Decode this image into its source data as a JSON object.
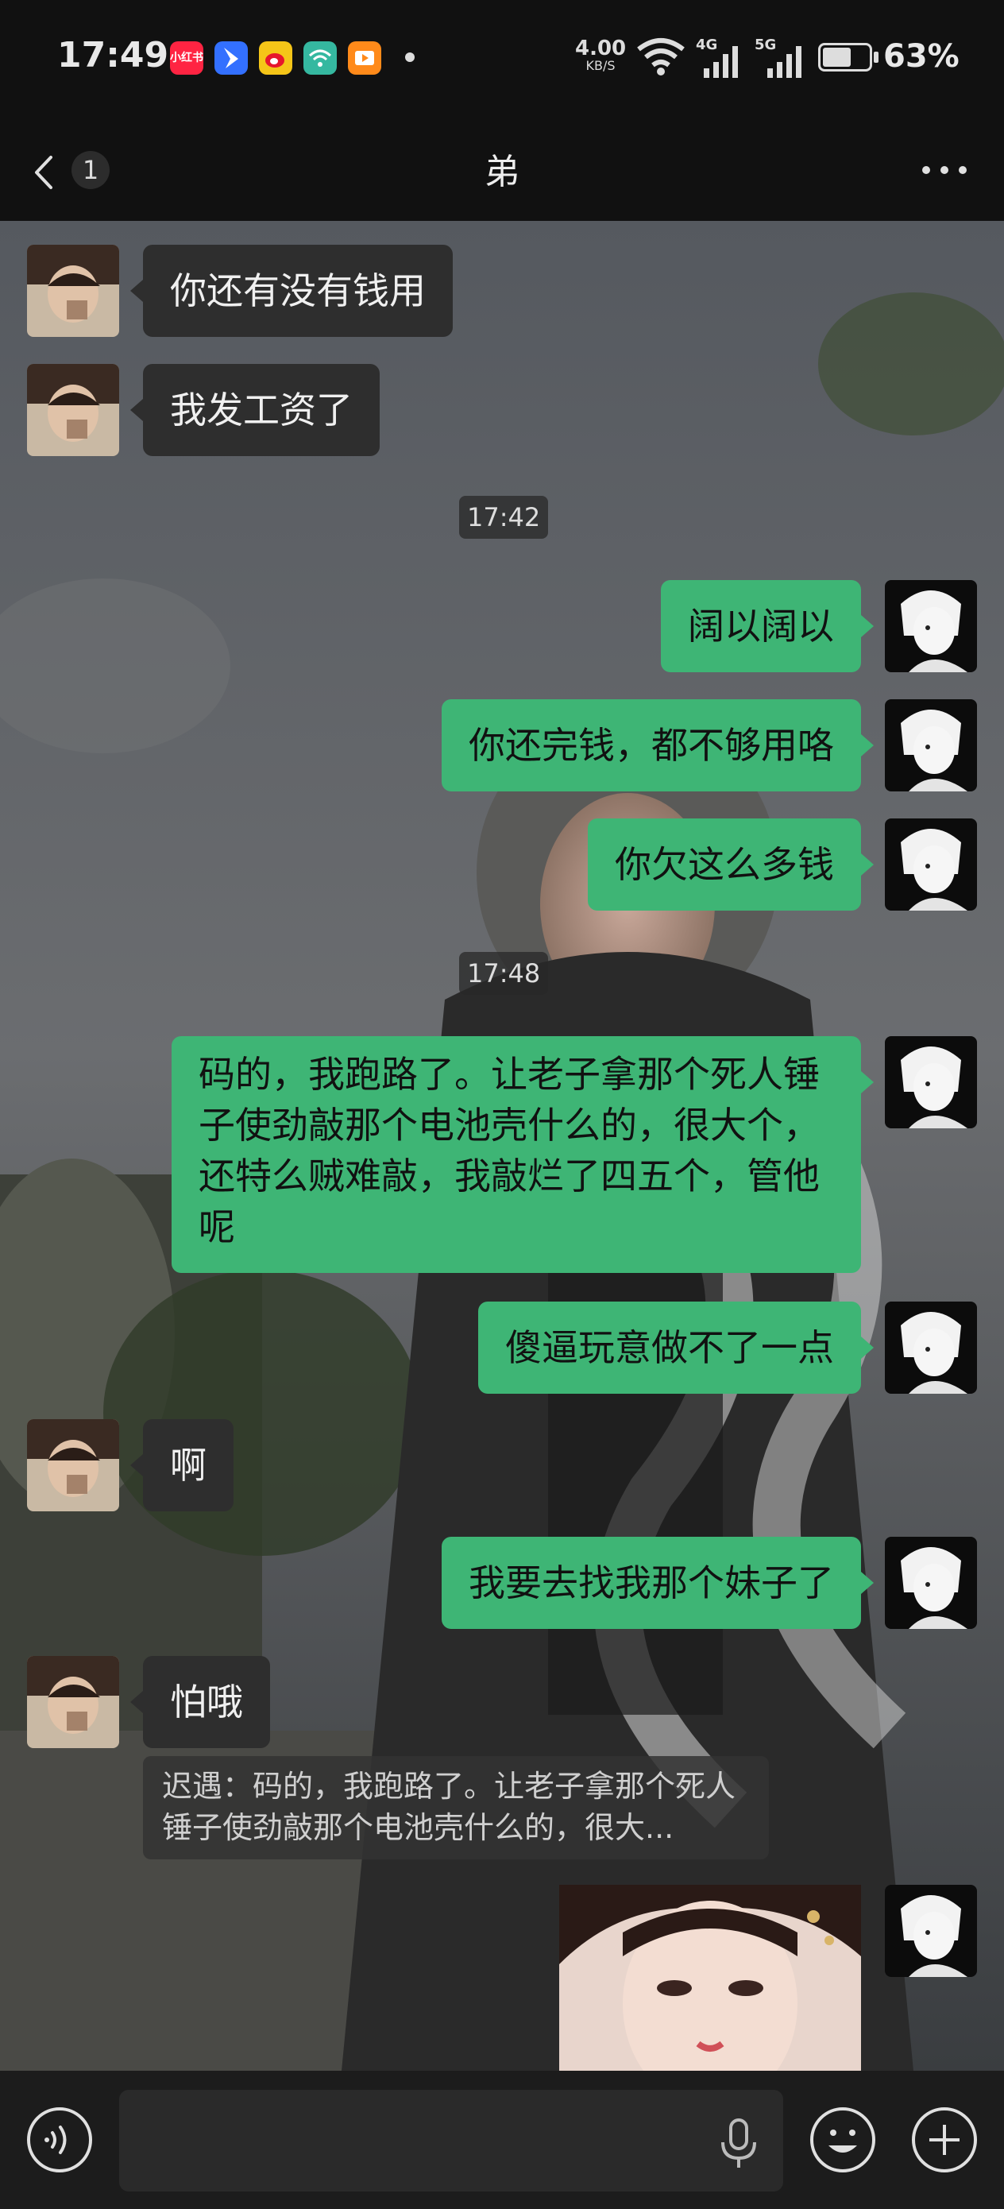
{
  "status": {
    "time": "17:49",
    "apps": [
      {
        "name": "xiaohongshu-app-icon",
        "text": "小红书",
        "color": "#ff2442"
      },
      {
        "name": "feishu-app-icon",
        "text": "",
        "color": "#3370ff"
      },
      {
        "name": "weibo-app-icon",
        "text": "",
        "color": "#f5c518"
      },
      {
        "name": "wifi-app-icon",
        "text": "",
        "color": "#35b8a0"
      },
      {
        "name": "video-app-icon",
        "text": "",
        "color": "#ff8a1a"
      }
    ],
    "net_speed": "4.00",
    "net_unit": "KB/S",
    "signal_4g": "4G",
    "signal_5g": "5G",
    "battery": "63%",
    "battery_level": 0.63
  },
  "nav": {
    "unread": "1",
    "title": "弟"
  },
  "messages": {
    "m1": "你还有没有钱用",
    "m2": "我发工资了",
    "t1": "17:42",
    "m3": "阔以阔以",
    "m4": "你还完钱，都不够用咯",
    "m5": "你欠这么多钱",
    "t2": "17:48",
    "m6": "码的，我跑路了。让老子拿那个死人锤子使劲敲那个电池壳什么的，很大个，还特么贼难敲，我敲烂了四五个，管他呢",
    "m7": "傻逼玩意做不了一点",
    "m8": "啊",
    "m9": "我要去找我那个妹子了",
    "m10": "怕哦",
    "quote": "迟遇：码的，我跑路了。让老子拿那个死人锤子使劲敲那个电池壳什么的，很大..."
  },
  "input": {
    "placeholder": ""
  },
  "colors": {
    "out_bubble": "#3eb575",
    "in_bubble": "#2e2e2e",
    "bar_bg": "#111111"
  }
}
